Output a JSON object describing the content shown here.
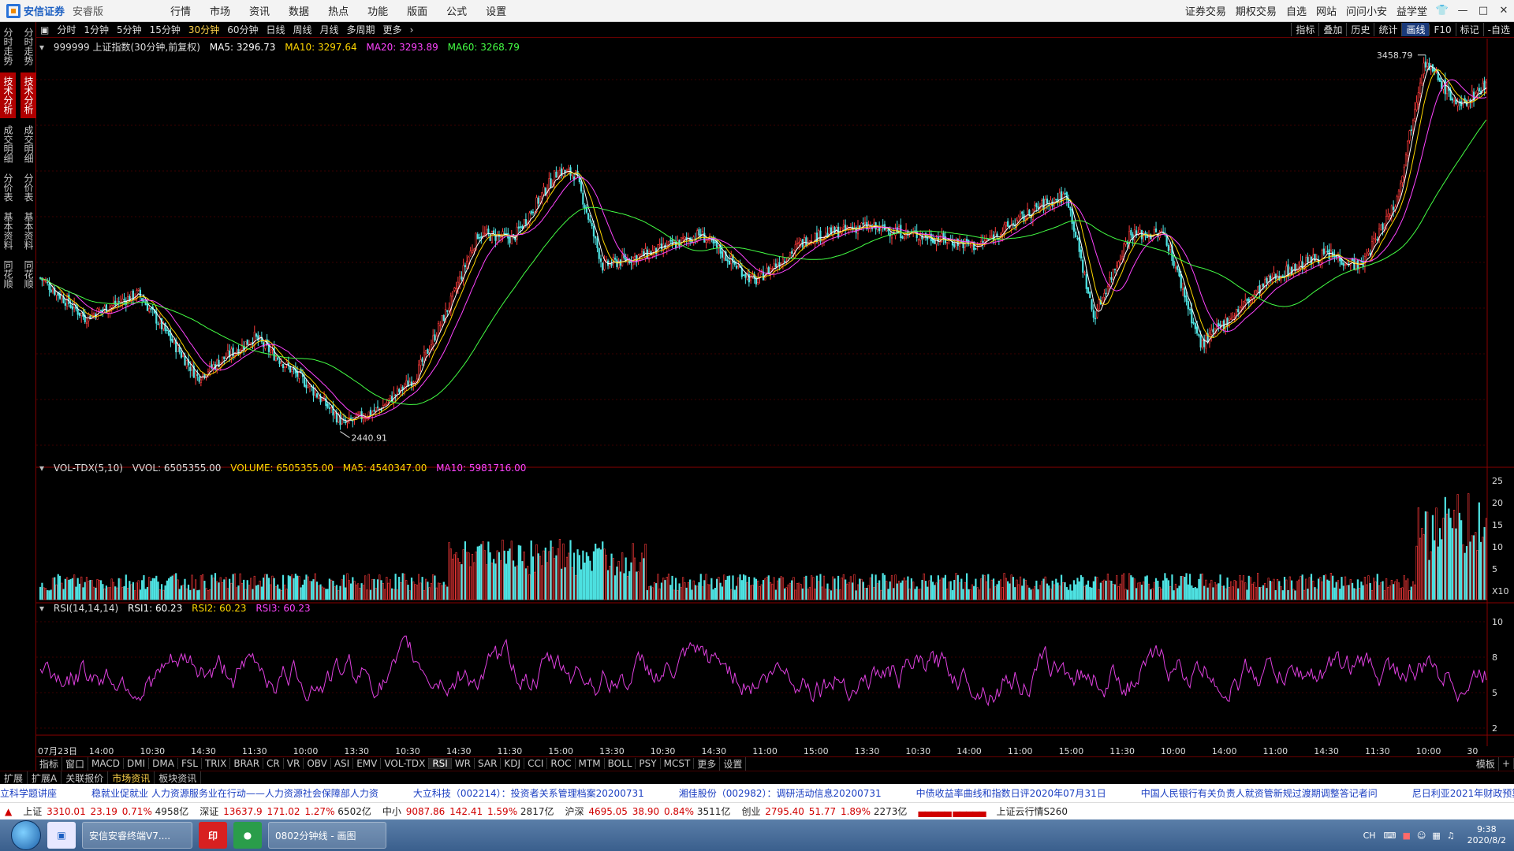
{
  "app": {
    "brand": "安信证券",
    "edition": "安睿版",
    "menus": [
      "行情",
      "市场",
      "资讯",
      "数据",
      "热点",
      "功能",
      "版面",
      "公式",
      "设置"
    ],
    "right_menus": [
      "证券交易",
      "期权交易",
      "自选",
      "网站",
      "问问小安",
      "益学堂"
    ],
    "window_controls": [
      "pin-icon",
      "minimize-icon",
      "maximize-icon",
      "close-icon"
    ]
  },
  "left_rail": {
    "outer_tabs": [
      "分时走势",
      "技术分析",
      "成交明细",
      "分价表",
      "基本资料",
      "同花顺"
    ],
    "inner_tabs": [
      "分时走势",
      "技术分析",
      "成交明细",
      "分价表",
      "基本资料",
      "同花顺"
    ],
    "active": "技术分析"
  },
  "period_bar": {
    "periods": [
      "分时",
      "1分钟",
      "5分钟",
      "15分钟",
      "30分钟",
      "60分钟",
      "日线",
      "周线",
      "月线",
      "多周期",
      "更多"
    ],
    "active": "30分钟",
    "tools": [
      "指标",
      "叠加",
      "历史",
      "统计",
      "画线",
      "F10",
      "标记",
      "-自选"
    ],
    "active_tool": "画线"
  },
  "main_legend": {
    "symbol": "999999 上证指数(30分钟,前复权)",
    "ma5": "MA5: 3296.73",
    "ma10": "MA10: 3297.64",
    "ma20": "MA20: 3293.89",
    "ma60": "MA60: 3268.79",
    "high_label": "3458.79",
    "low_label": "2440.91"
  },
  "vol_legend": {
    "name": "VOL-TDX(5,10)",
    "vvol": "VVOL: 6505355.00",
    "volume": "VOLUME: 6505355.00",
    "ma5": "MA5: 4540347.00",
    "ma10": "MA10: 5981716.00",
    "scale": [
      "25",
      "20",
      "15",
      "10",
      "5",
      "X10"
    ]
  },
  "rsi_legend": {
    "name": "RSI(14,14,14)",
    "rsi1": "RSI1: 60.23",
    "rsi2": "RSI2: 60.23",
    "rsi3": "RSI3: 60.23",
    "scale": [
      "10",
      "8",
      "5",
      "2"
    ]
  },
  "time_axis": [
    "07月23日",
    "14:00",
    "10:30",
    "14:30",
    "11:30",
    "10:00",
    "13:30",
    "10:30",
    "14:30",
    "11:30",
    "15:00",
    "13:30",
    "10:30",
    "14:30",
    "11:00",
    "15:00",
    "13:30",
    "10:30",
    "14:00",
    "11:00",
    "15:00",
    "11:30",
    "10:00",
    "14:00",
    "11:00",
    "14:30",
    "11:30",
    "10:00",
    "30"
  ],
  "indicator_tabs": [
    "指标",
    "窗口",
    "MACD",
    "DMI",
    "DMA",
    "FSL",
    "TRIX",
    "BRAR",
    "CR",
    "VR",
    "OBV",
    "ASI",
    "EMV",
    "VOL-TDX",
    "RSI",
    "WR",
    "SAR",
    "KDJ",
    "CCI",
    "ROC",
    "MTM",
    "BOLL",
    "PSY",
    "MCST",
    "更多",
    "设置"
  ],
  "active_indicator": "RSI",
  "template_label": "模板",
  "ext_tabs": [
    "扩展",
    "扩展A",
    "关联报价",
    "市场资讯",
    "板块资讯"
  ],
  "active_ext": "市场资讯",
  "news": [
    "立科学题讲座",
    "稳就业促就业 人力资源服务业在行动——人力资源社会保障部人力资",
    "大立科技（002214）：投资者关系管理档案20200731",
    "湘佳股份（002982）：调研活动信息20200731",
    "中债收益率曲线和指数日评2020年07月31日",
    "中国人民银行有关负责人就资管新规过渡期调整答记者问",
    "尼日利亚2021年财政预算12万亿奈拉"
  ],
  "quotes": [
    {
      "name": "上证",
      "price": "3310.01",
      "chg": "23.19",
      "pct": "0.71%",
      "amt": "4958亿"
    },
    {
      "name": "深证",
      "price": "13637.9",
      "chg": "171.02",
      "pct": "1.27%",
      "amt": "6502亿"
    },
    {
      "name": "中小",
      "price": "9087.86",
      "chg": "142.41",
      "pct": "1.59%",
      "amt": "2817亿"
    },
    {
      "name": "沪深",
      "price": "4695.05",
      "chg": "38.90",
      "pct": "0.84%",
      "amt": "3511亿"
    },
    {
      "name": "创业",
      "price": "2795.40",
      "chg": "51.77",
      "pct": "1.89%",
      "amt": "2273亿"
    }
  ],
  "quote_extra": "上证云行情S260",
  "taskbar": {
    "apps": [
      "安信安睿终端V7....",
      "0802分钟线 - 画图"
    ],
    "time": "9:38",
    "date": "2020/8/2",
    "ime": "CH"
  },
  "colors": {
    "up": "#ff3b3b",
    "down": "#4fe4e4",
    "ma5": "#ffffff",
    "ma10": "#ffd700",
    "ma20": "#ff44ff",
    "ma60": "#44ff44",
    "rsi": "#e040e0"
  },
  "chart_data": [
    {
      "type": "candlestick",
      "title": "999999 上证指数(30分钟,前复权)",
      "ylim": [
        2420,
        3470
      ],
      "annotations": [
        {
          "label": "3458.79",
          "type": "max"
        },
        {
          "label": "2440.91",
          "type": "min"
        }
      ],
      "anchors": [
        [
          0,
          2890
        ],
        [
          25,
          2790
        ],
        [
          55,
          2850
        ],
        [
          88,
          2640
        ],
        [
          120,
          2740
        ],
        [
          150,
          2620
        ],
        [
          170,
          2520
        ],
        [
          190,
          2560
        ],
        [
          210,
          2640
        ],
        [
          230,
          2830
        ],
        [
          245,
          3000
        ],
        [
          265,
          2990
        ],
        [
          290,
          3160
        ],
        [
          300,
          3150
        ],
        [
          315,
          2920
        ],
        [
          340,
          2950
        ],
        [
          370,
          3000
        ],
        [
          400,
          2880
        ],
        [
          430,
          2990
        ],
        [
          460,
          3020
        ],
        [
          490,
          3000
        ],
        [
          525,
          2970
        ],
        [
          560,
          3070
        ],
        [
          575,
          3100
        ],
        [
          590,
          2790
        ],
        [
          610,
          3000
        ],
        [
          630,
          3000
        ],
        [
          650,
          2720
        ],
        [
          690,
          2890
        ],
        [
          720,
          2950
        ],
        [
          740,
          2920
        ],
        [
          760,
          3090
        ],
        [
          775,
          3440
        ],
        [
          795,
          3320
        ],
        [
          810,
          3380
        ]
      ],
      "series": [
        {
          "name": "MA5"
        },
        {
          "name": "MA10"
        },
        {
          "name": "MA20"
        },
        {
          "name": "MA60"
        }
      ]
    },
    {
      "type": "bar",
      "title": "VOL-TDX(5,10)",
      "ylim": [
        0,
        280
      ],
      "note": "volume bars, x10 scale"
    },
    {
      "type": "line",
      "title": "RSI(14,14,14)",
      "ylim": [
        0,
        100
      ]
    }
  ]
}
